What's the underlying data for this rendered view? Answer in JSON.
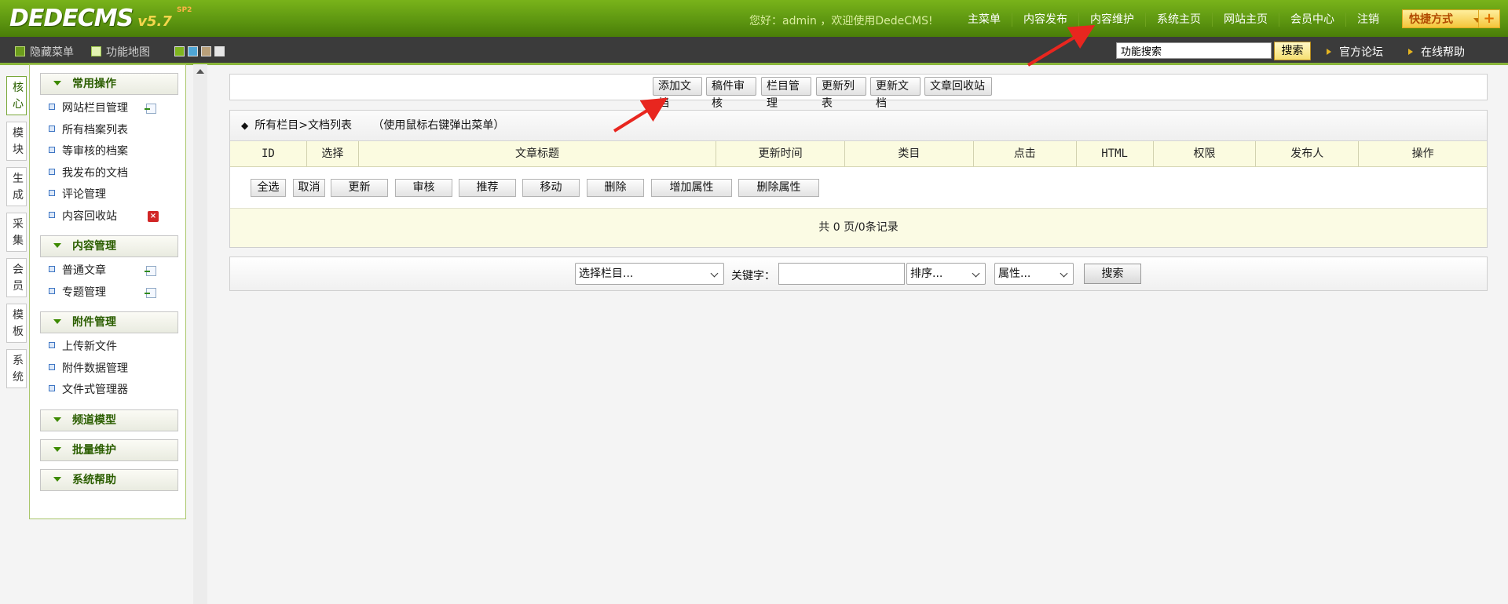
{
  "header": {
    "logo_text": "DEDECMS",
    "logo_version": "v5.7",
    "logo_sup": "SP2",
    "welcome": "您好：admin ，欢迎使用DedeCMS!",
    "nav": [
      "主菜单",
      "内容发布",
      "内容维护",
      "系统主页",
      "网站主页",
      "会员中心",
      "注销"
    ],
    "quick_label": "快捷方式",
    "quick_plus": "+"
  },
  "subbar": {
    "hide_menu": "隐藏菜单",
    "function_map": "功能地图",
    "swatch_colors": [
      "#7fb51f",
      "#4fa6d6",
      "#b9a07a",
      "#e6e6e6"
    ],
    "search_value": "功能搜索",
    "search_button": "搜索",
    "forum_link": "官方论坛",
    "help_link": "在线帮助"
  },
  "tabs": [
    {
      "label": "核心",
      "chars": [
        "核",
        "心"
      ]
    },
    {
      "label": "模块",
      "chars": [
        "模",
        "块"
      ]
    },
    {
      "label": "生成",
      "chars": [
        "生",
        "成"
      ]
    },
    {
      "label": "采集",
      "chars": [
        "采",
        "集"
      ]
    },
    {
      "label": "会员",
      "chars": [
        "会",
        "员"
      ]
    },
    {
      "label": "模板",
      "chars": [
        "模",
        "板"
      ]
    },
    {
      "label": "系统",
      "chars": [
        "系",
        "统"
      ]
    }
  ],
  "menu": {
    "sections": [
      {
        "title": "常用操作",
        "items": [
          {
            "label": "网站栏目管理",
            "icon": "add"
          },
          {
            "label": "所有档案列表",
            "icon": ""
          },
          {
            "label": "等审核的档案",
            "icon": ""
          },
          {
            "label": "我发布的文档",
            "icon": ""
          },
          {
            "label": "评论管理",
            "icon": ""
          },
          {
            "label": "内容回收站",
            "icon": "delete"
          }
        ]
      },
      {
        "title": "内容管理",
        "items": [
          {
            "label": "普通文章",
            "icon": "add"
          },
          {
            "label": "专题管理",
            "icon": "add"
          }
        ]
      },
      {
        "title": "附件管理",
        "items": [
          {
            "label": "上传新文件",
            "icon": ""
          },
          {
            "label": "附件数据管理",
            "icon": ""
          },
          {
            "label": "文件式管理器",
            "icon": ""
          }
        ]
      },
      {
        "title": "频道模型",
        "items": []
      },
      {
        "title": "批量维护",
        "items": []
      },
      {
        "title": "系统帮助",
        "items": []
      }
    ]
  },
  "toolbar": {
    "buttons": [
      "添加文档",
      "稿件审核",
      "栏目管理",
      "更新列表",
      "更新文档",
      "文章回收站"
    ]
  },
  "list": {
    "breadcrumb_marker": "◆",
    "breadcrumb": "所有栏目>文档列表",
    "breadcrumb_hint": "（使用鼠标右键弹出菜单）",
    "columns": [
      "ID",
      "选择",
      "文章标题",
      "更新时间",
      "类目",
      "点击",
      "HTML",
      "权限",
      "发布人",
      "操作"
    ],
    "actions": [
      "全选",
      "取消",
      "更新",
      "审核",
      "推荐",
      "移动",
      "删除",
      "增加属性",
      "删除属性"
    ],
    "pager": "共 0 页/0条记录"
  },
  "filter": {
    "category_select": "选择栏目...",
    "keyword_label": "关键字：",
    "keyword_value": "",
    "order_select": "排序...",
    "attr_select": "属性...",
    "search_button": "搜索"
  },
  "colors": {
    "header_green": "#5b9410",
    "accent_gold": "#f3c53a",
    "table_header_bg": "#fbfbe0",
    "annotation_arrow": "#e8261f"
  }
}
